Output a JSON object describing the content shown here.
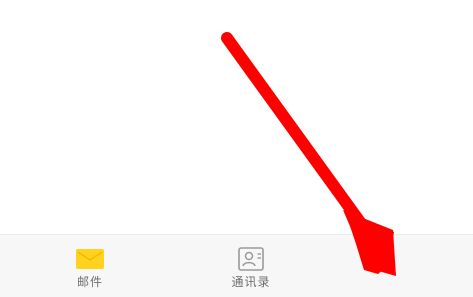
{
  "tab_bar": {
    "tabs": [
      {
        "label": "邮件",
        "icon": "mail-icon",
        "color": "#FFD21E"
      },
      {
        "label": "通讯录",
        "icon": "contacts-icon",
        "color": "#9a9a9a"
      },
      {
        "label": "",
        "icon": ""
      }
    ]
  },
  "annotation": {
    "arrow_color": "#FF0000"
  }
}
